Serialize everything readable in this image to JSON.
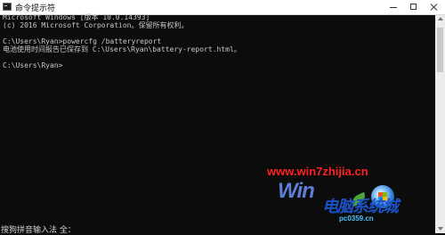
{
  "window": {
    "title": "命令提示符",
    "controls": {
      "minimize": "minimize",
      "maximize": "maximize",
      "close": "close"
    }
  },
  "console": {
    "lines": [
      "Microsoft Windows [版本 10.0.14393]",
      "(c) 2016 Microsoft Corporation。保留所有权利。",
      "",
      "C:\\Users\\Ryan>powercfg /batteryreport",
      "电池使用时间报告已保存到 C:\\Users\\Ryan\\battery-report.html。",
      "",
      "C:\\Users\\Ryan>"
    ]
  },
  "ime": {
    "status": "搜狗拼音输入法 全："
  },
  "watermark": {
    "url": "www.win7zhijia.cn",
    "logo_text": "Win",
    "stamp_text": "电脑系统城",
    "site_text": "pc0359.cn",
    "colors": {
      "url": "#ff2020",
      "logo": "#5c7fd5",
      "stamp": "#1c51c6",
      "site": "#4dc3ff"
    }
  }
}
